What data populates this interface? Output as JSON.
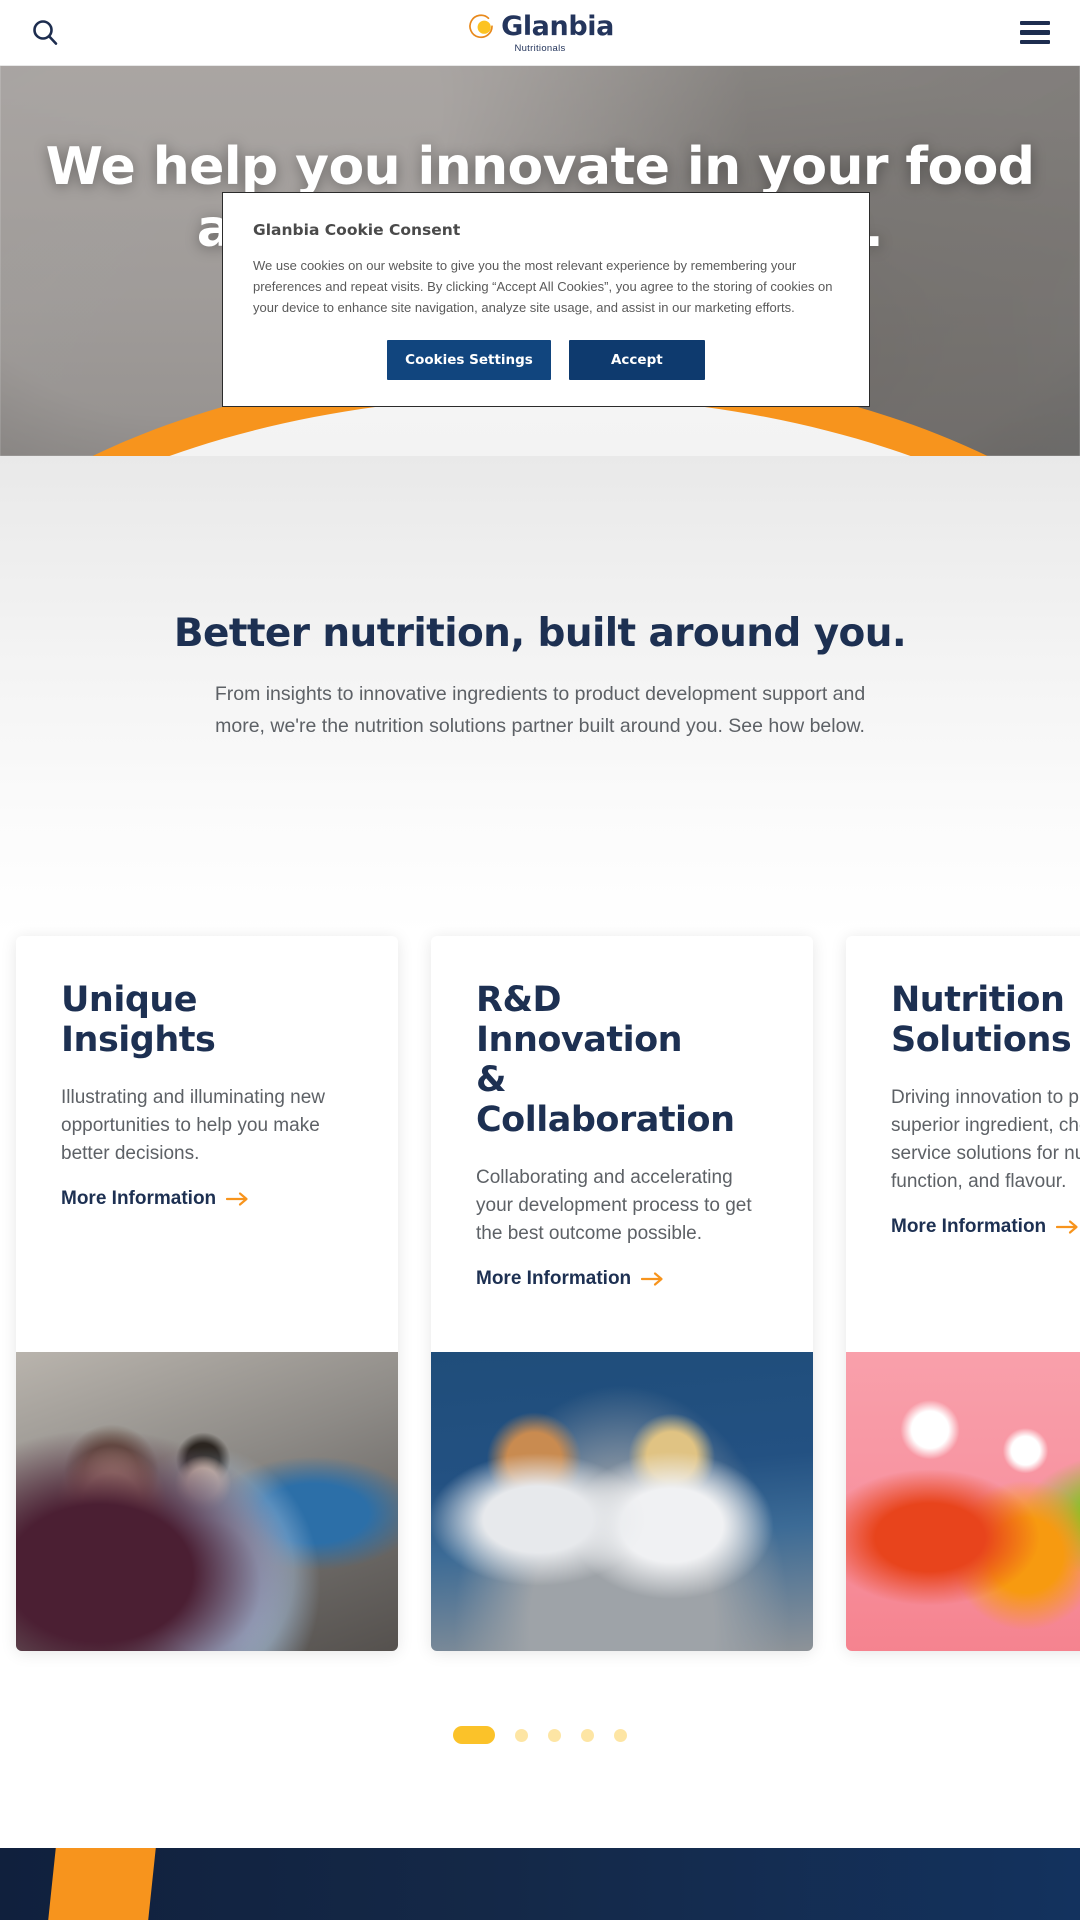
{
  "header": {
    "search_icon": "search-icon",
    "menu_icon": "hamburger-menu-icon",
    "logo": {
      "word": "Glanbia",
      "sub": "Nutritionals",
      "icon": "glanbia-circle-logo-icon"
    }
  },
  "hero": {
    "headline": "We help you innovate in your food and beverage products.",
    "scroll_icon": "chevron-down-icon",
    "arc_color": "#f7941d"
  },
  "intro": {
    "title": "Better nutrition, built around you.",
    "copy": "From insights to innovative ingredients to product development support and more, we're the nutrition solutions partner built around you. See how below."
  },
  "cards": [
    {
      "title": "Unique\nInsights",
      "desc": "Illustrating and illuminating new opportunities to help you make better decisions.",
      "link": "More Information",
      "link_icon": "arrow-right-icon",
      "image": "office-whiteboard-meeting-photo"
    },
    {
      "title": "R&D Innovation\n& Collaboration",
      "desc": "Collaborating and accelerating your development process to get the best outcome possible.",
      "link": "More Information",
      "link_icon": "arrow-right-icon",
      "image": "lab-scientists-kitchen-photo"
    },
    {
      "title": "Nutrition\nSolutions",
      "desc": "Driving innovation to provide superior ingredient, cheese, and service solutions for nutrition, function, and flavour.",
      "link": "More Information",
      "link_icon": "arrow-right-icon",
      "image": "colored-juice-bottles-photo"
    }
  ],
  "carousel": {
    "dot_count": 5,
    "active_index": 0,
    "dot_color": "#fbc229"
  },
  "cookie_modal": {
    "title": "Glanbia Cookie Consent",
    "text": "We use cookies on our website to give you the most relevant experience by remembering your preferences and repeat visits. By clicking “Accept All Cookies”, you agree to the storing of cookies on your device to enhance site navigation, analyze site usage, and assist in our marketing efforts.",
    "settings_label": "Cookies Settings",
    "accept_label": "Accept",
    "settings_color": "#11457e",
    "accept_color": "#0e3a6e"
  },
  "footer": {
    "accent_color": "#f7941d",
    "background_color": "#10203d"
  },
  "theme": {
    "navy": "#1d3052",
    "orange": "#f7941d",
    "gold": "#fbc229",
    "body_gray": "#5d6166"
  }
}
